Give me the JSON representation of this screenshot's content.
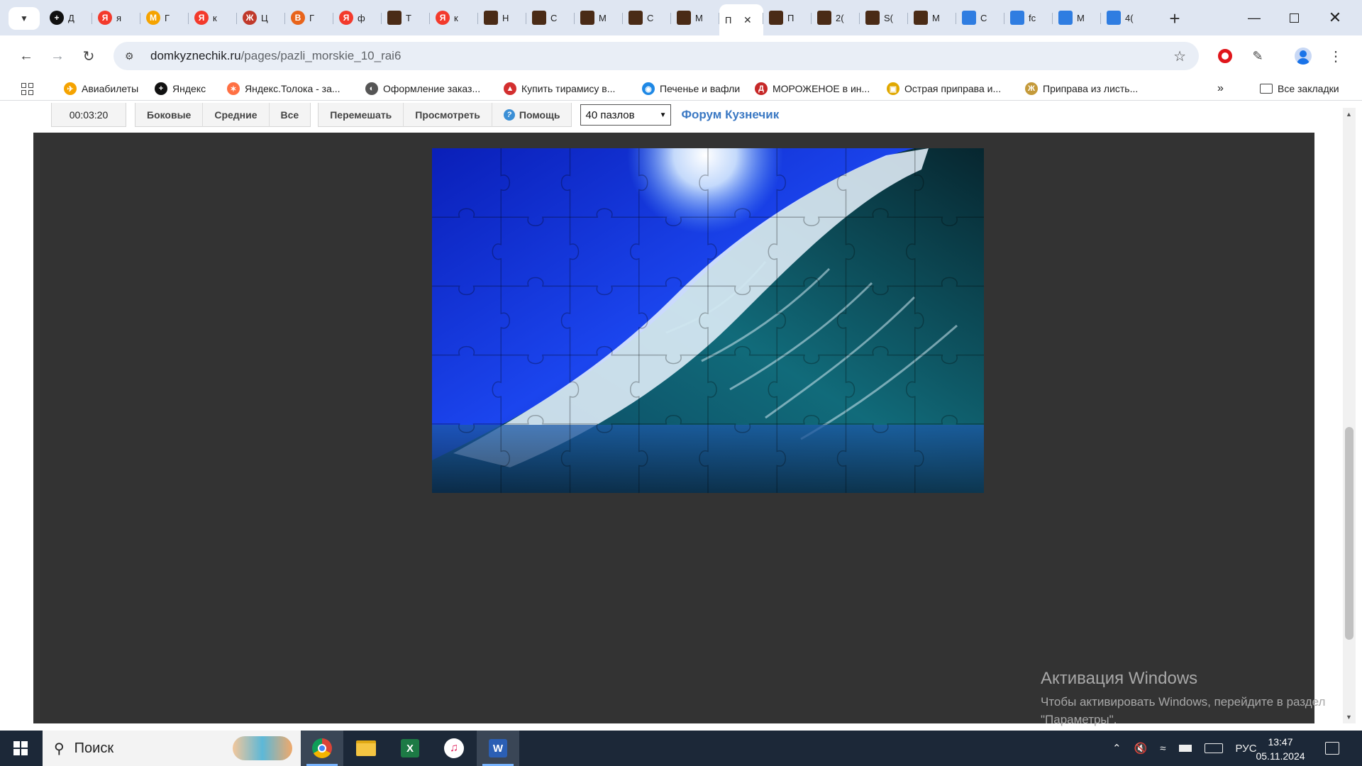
{
  "tabs": [
    {
      "title": "Д",
      "color": "#111111",
      "glyph": "+"
    },
    {
      "title": "я",
      "color": "#f33a2c",
      "glyph": "Я"
    },
    {
      "title": "Г",
      "color": "#f5a300",
      "glyph": "M"
    },
    {
      "title": "к",
      "color": "#f33a2c",
      "glyph": "Я"
    },
    {
      "title": "Ц",
      "color": "#c0392b",
      "glyph": "Ж"
    },
    {
      "title": "Г",
      "color": "#e8641b",
      "glyph": "B"
    },
    {
      "title": "ф",
      "color": "#f33a2c",
      "glyph": "Я"
    },
    {
      "title": "Т",
      "color": "#4a2b16",
      "glyph": ""
    },
    {
      "title": "к",
      "color": "#f33a2c",
      "glyph": "Я"
    },
    {
      "title": "Н",
      "color": "#4a2b16",
      "glyph": ""
    },
    {
      "title": "С",
      "color": "#4a2b16",
      "glyph": ""
    },
    {
      "title": "М",
      "color": "#4a2b16",
      "glyph": ""
    },
    {
      "title": "С",
      "color": "#4a2b16",
      "glyph": ""
    },
    {
      "title": "М",
      "color": "#4a2b16",
      "glyph": ""
    },
    {
      "title": "П",
      "color": "#ffffff",
      "glyph": "",
      "active": true
    },
    {
      "title": "П",
      "color": "#4a2b16",
      "glyph": ""
    },
    {
      "title": "2(",
      "color": "#4a2b16",
      "glyph": ""
    },
    {
      "title": "S(",
      "color": "#4a2b16",
      "glyph": ""
    },
    {
      "title": "М",
      "color": "#4a2b16",
      "glyph": ""
    },
    {
      "title": "С",
      "color": "#2f7de1",
      "glyph": ""
    },
    {
      "title": "fc",
      "color": "#2f7de1",
      "glyph": ""
    },
    {
      "title": "М",
      "color": "#2f7de1",
      "glyph": ""
    },
    {
      "title": "4(",
      "color": "#2f7de1",
      "glyph": ""
    }
  ],
  "address": {
    "domain": "domkyznechik.ru",
    "path": "/pages/pazli_morskie_10_rai6"
  },
  "bookmarks": [
    {
      "label": "Авиабилеты",
      "color": "#f5a300",
      "glyph": "✈"
    },
    {
      "label": "Яндекс",
      "color": "#111111",
      "glyph": "+"
    },
    {
      "label": "Яндекс.Толока - за...",
      "color": "#ff7043",
      "glyph": "✶"
    },
    {
      "label": "Оформление заказ...",
      "color": "#555555",
      "glyph": "◐"
    },
    {
      "label": "Купить тирамису в...",
      "color": "#d32f2f",
      "glyph": "▲"
    },
    {
      "label": "Печенье и вафли",
      "color": "#1e88e5",
      "glyph": "◉"
    },
    {
      "label": "МОРОЖЕНОЕ в ин...",
      "color": "#c62828",
      "glyph": "Д"
    },
    {
      "label": "Острая приправа и...",
      "color": "#e0a800",
      "glyph": "▣"
    },
    {
      "label": "Приправа из листь...",
      "color": "#c49a3a",
      "glyph": "Ж"
    }
  ],
  "all_bookmarks_label": "Все закладки",
  "puzzle_controls": {
    "timer": "00:03:20",
    "side": "Боковые",
    "middle": "Средние",
    "all": "Все",
    "shuffle": "Перемешать",
    "preview": "Просмотреть",
    "help": "Помощь",
    "pieces_select": "40 пазлов",
    "forum_link": "Форум Кузнечик"
  },
  "puzzle": {
    "columns": 8,
    "rows": 5,
    "colors": {
      "sky": "#0a2fd8",
      "deep": "#0b3340",
      "foam": "#e8f4ff",
      "board": "#333333"
    }
  },
  "watermark": {
    "title": "Активация Windows",
    "text": "Чтобы активировать Windows, перейдите в раздел \"Параметры\"."
  },
  "taskbar": {
    "search_label": "Поиск",
    "language": "РУС",
    "time": "13:47",
    "date": "05.11.2024"
  }
}
